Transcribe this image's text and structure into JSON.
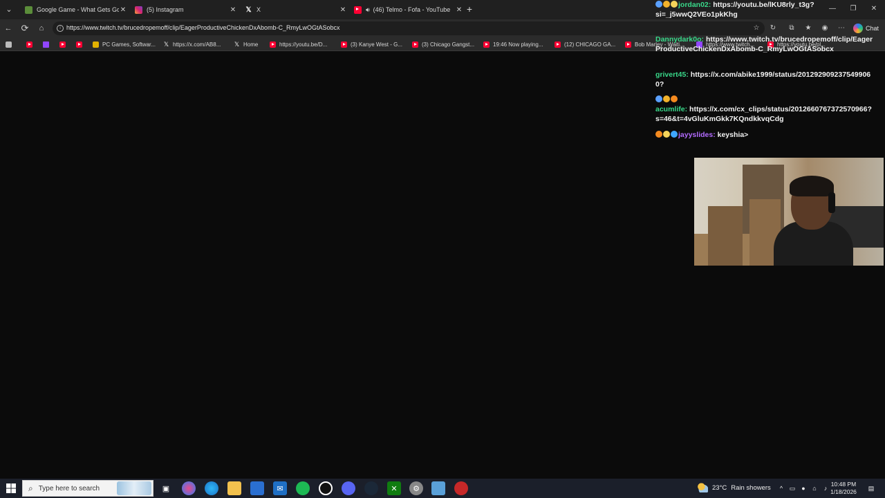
{
  "browser": {
    "tabs": [
      {
        "title": "Google Game - What Gets Google",
        "icon": "game-icon"
      },
      {
        "title": "(5) Instagram",
        "icon": "instagram-icon"
      },
      {
        "title": "X",
        "icon": "x-icon"
      },
      {
        "title": "(46) Telmo - Fofa - YouTube",
        "icon": "youtube-icon",
        "audio": true,
        "active": true
      }
    ],
    "url": "https://www.twitch.tv/brucedropemoff/clip/EagerProductiveChickenDxAbomb-C_RmyLwOGtASobcx",
    "chat_label": "Chat",
    "bookmarks": [
      {
        "label": "",
        "icon": "youtube-icon"
      },
      {
        "label": "",
        "icon": "twitch-icon"
      },
      {
        "label": "",
        "icon": "youtube-icon"
      },
      {
        "label": "",
        "icon": "youtube-icon"
      },
      {
        "label": "PC Games, Softwar...",
        "icon": "steam-icon"
      },
      {
        "label": "https://x.com/AB8...",
        "icon": "x-icon"
      },
      {
        "label": "Home",
        "icon": "x-icon"
      },
      {
        "label": "https://youtu.be/D...",
        "icon": "youtube-icon"
      },
      {
        "label": "(3) Kanye West - G...",
        "icon": "youtube-icon"
      },
      {
        "label": "(3) Chicago Gangst...",
        "icon": "youtube-icon"
      },
      {
        "label": "19:46 Now playing...",
        "icon": "youtube-icon"
      },
      {
        "label": "(12) CHICAGO GA...",
        "icon": "youtube-icon"
      },
      {
        "label": "Bob Marley - Waiti...",
        "icon": "youtube-icon"
      },
      {
        "label": "https://www.twitch...",
        "icon": "twitch-icon"
      },
      {
        "label": "https://youtu.be/pl...",
        "icon": "youtube-icon"
      }
    ]
  },
  "chat": {
    "messages": [
      {
        "user": "jordan02:",
        "user_color": "#39d98a",
        "text_line1": "https://youtu.be/lKU8rly_t3g?",
        "text_line2": "si=_j5wwQ2VEo1pkKhg"
      },
      {
        "user": "Dannydark0o:",
        "user_color": "#39d98a",
        "text_line1": "https://www.twitch.tv/brucedropemoff/clip/Eager",
        "text_line2": "ProductiveChickenDxAbomb-C_RmyLwOGtASobcx"
      },
      {
        "user": "grivert45:",
        "user_color": "#39d98a",
        "text_line1": "https://x.com/abike1999/status/201292909237549906",
        "text_line2": "0?"
      },
      {
        "user": "acumlife:",
        "user_color": "#39d98a",
        "text_line1": "https://x.com/cx_clips/status/2012660767372570966?",
        "text_line2": "s=46&t=4vGluKmGkk7KQndkkvqCdg"
      },
      {
        "user": "jayyslides:",
        "user_color": "#b36bff",
        "text_line1": "keyshia>",
        "text_line2": ""
      }
    ]
  },
  "taskbar": {
    "search_placeholder": "Type here to search",
    "weather_temp": "23°C",
    "weather_text": "Rain showers",
    "time": "10:48 PM",
    "date": "1/18/2026"
  }
}
